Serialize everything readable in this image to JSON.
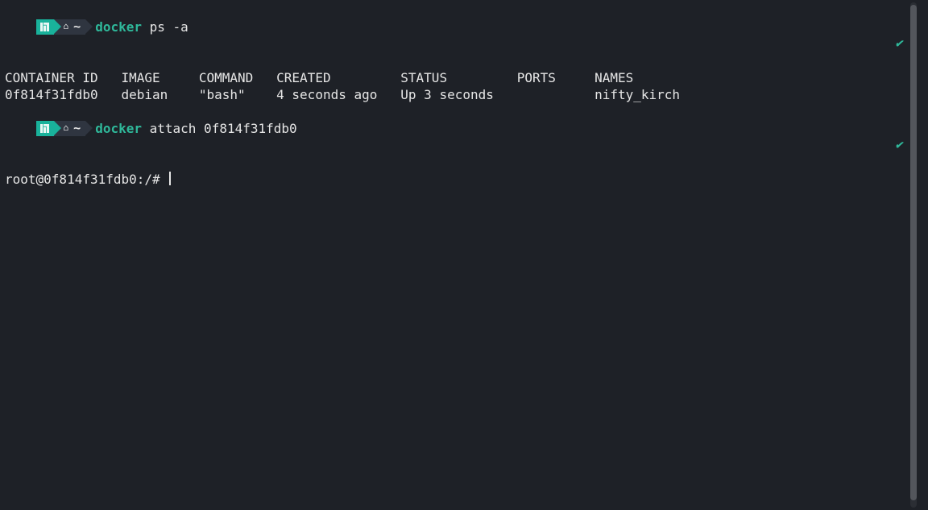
{
  "prompt": {
    "home_glyph": "⌂",
    "tilde": "~"
  },
  "lines": {
    "cmd1_docker": "docker",
    "cmd1_args": "ps -a",
    "table_header": "CONTAINER ID   IMAGE     COMMAND   CREATED         STATUS         PORTS     NAMES",
    "table_row": "0f814f31fdb0   debian    \"bash\"    4 seconds ago   Up 3 seconds             nifty_kirch",
    "cmd2_docker": "docker",
    "cmd2_args": "attach 0f814f31fdb0",
    "root_prompt": "root@0f814f31fdb0:/# "
  },
  "status_check": "✔"
}
